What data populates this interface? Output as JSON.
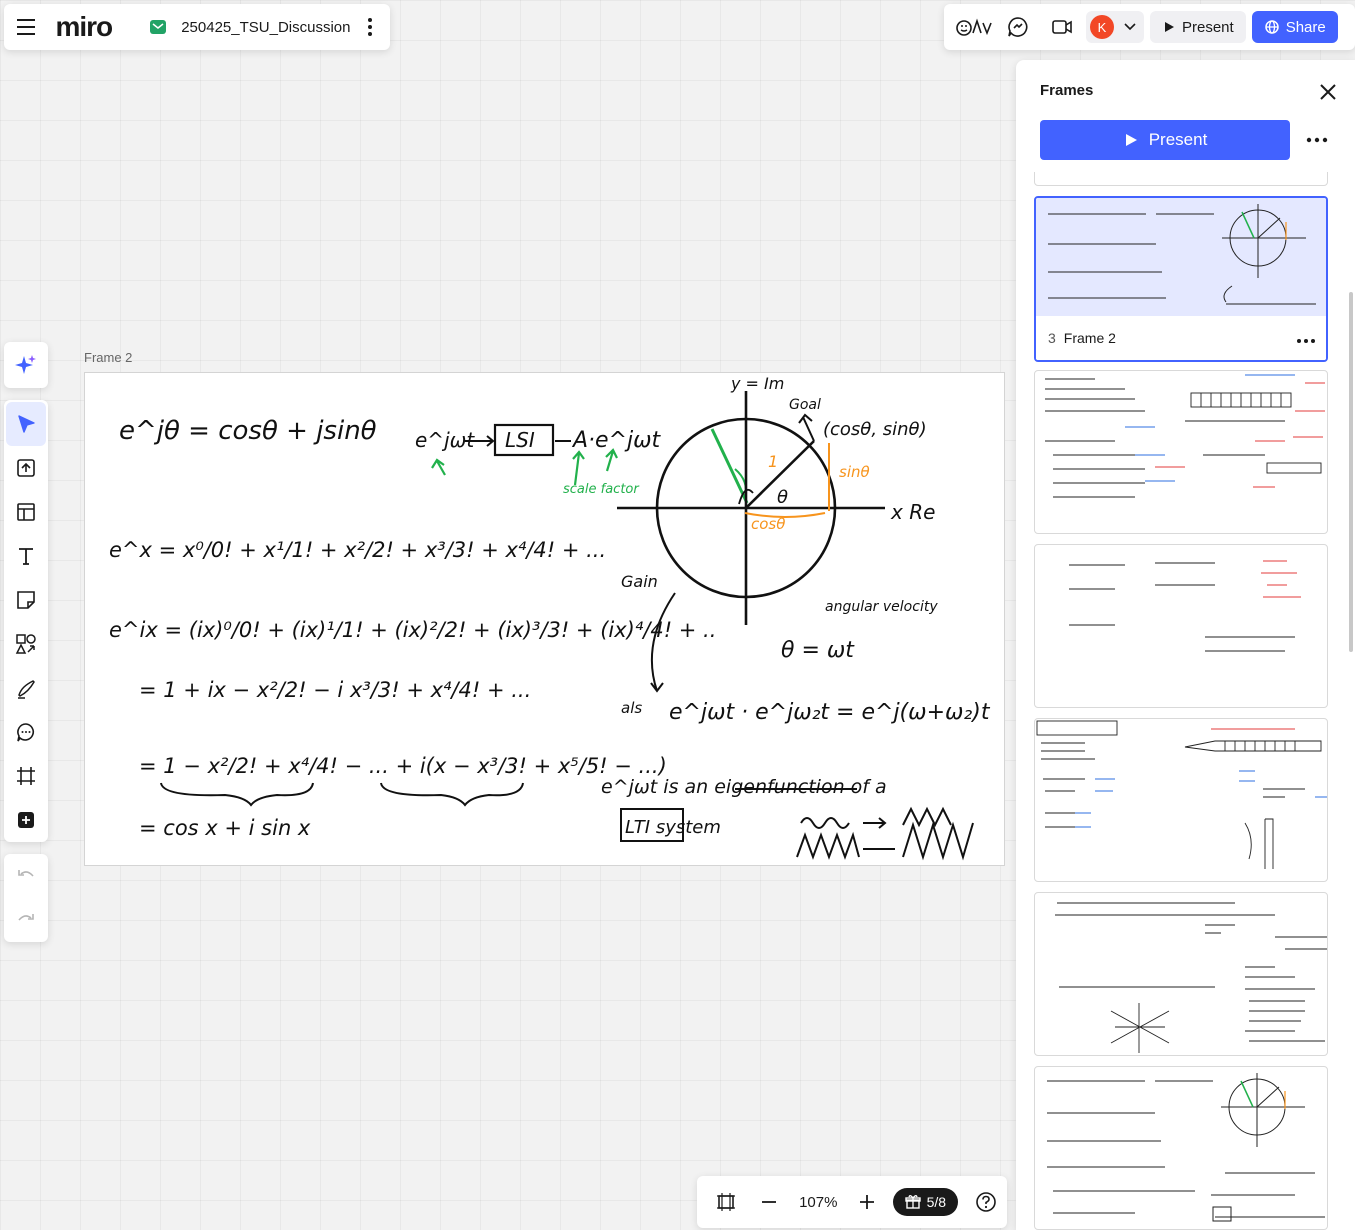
{
  "header": {
    "logo": "miro",
    "board_title": "250425_TSU_Discussion"
  },
  "topbar": {
    "avatar_initial": "K",
    "present_label": "Present",
    "share_label": "Share"
  },
  "toolbar": {
    "tools": [
      "ai-sparkle",
      "select",
      "upload",
      "templates",
      "text",
      "sticky-note",
      "shapes",
      "pen",
      "comment",
      "frame",
      "more"
    ]
  },
  "canvas": {
    "frame_label": "Frame 2",
    "whiteboard": {
      "euler": "e^jθ = cosθ + jsinθ",
      "lsi_input": "e^jωt",
      "lsi_box": "LSI",
      "lsi_output": "A·e^jωt",
      "scale_note": "scale factor",
      "series_1": "e^x = x⁰/0! + x¹/1! + x²/2! + x³/3! + x⁴/4! + ...",
      "series_2": "e^ix = (ix)⁰/0! + (ix)¹/1! + (ix)²/2! + (ix)³/3! + (ix)⁴/4! + ..",
      "series_3": "= 1 + ix − x²/2! − i x³/3! + x⁴/4! + ...",
      "series_4": "= 1 − x²/2! + x⁴/4! − ...  + i(x − x³/3! + x⁵/5! − ...)",
      "series_5": "= cos x          + i sin x",
      "axis_y": "y = Im",
      "axis_x": "x  Re",
      "goal": "Goal",
      "point": "(cosθ, sinθ)",
      "sin": "sinθ",
      "cos": "cosθ",
      "one": "1",
      "theta": "θ",
      "gain": "Gain",
      "angular": "angular velocity",
      "theta_eq": "θ = ωt",
      "also": "als",
      "product": "e^jωt · e^jω₂t = e^j(ω+ω₂)t",
      "eigen": "e^jωt is an eigenfunction of a",
      "lti": "LTI system"
    }
  },
  "frames_panel": {
    "title": "Frames",
    "present_label": "Present",
    "frames": [
      {
        "number": "3",
        "name": "Frame 2",
        "selected": true
      }
    ]
  },
  "bottombar": {
    "zoom": "107%",
    "page": "5/8"
  },
  "colors": {
    "accent": "#4262ff",
    "green_ink": "#22b14c",
    "orange_ink": "#f7941d",
    "blue_ink": "#2d6fe0",
    "red_ink": "#e33b3b"
  }
}
